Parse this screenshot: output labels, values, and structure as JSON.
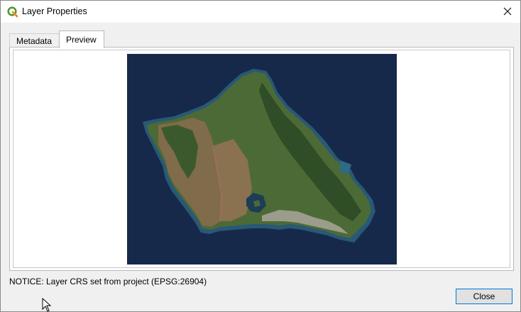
{
  "window": {
    "title": "Layer Properties"
  },
  "tabs": [
    {
      "label": "Metadata",
      "active": false
    },
    {
      "label": "Preview",
      "active": true
    }
  ],
  "notice": "NOTICE: Layer CRS set from project (EPSG:26904)",
  "buttons": {
    "close_label": "Close"
  },
  "colors": {
    "accent": "#0078d7",
    "ocean": "#17294a",
    "qgis_green": "#589632",
    "qgis_yellow": "#ee7913"
  },
  "icons": {
    "app": "qgis-logo-icon",
    "close": "close-icon",
    "cursor": "mouse-cursor-icon"
  }
}
